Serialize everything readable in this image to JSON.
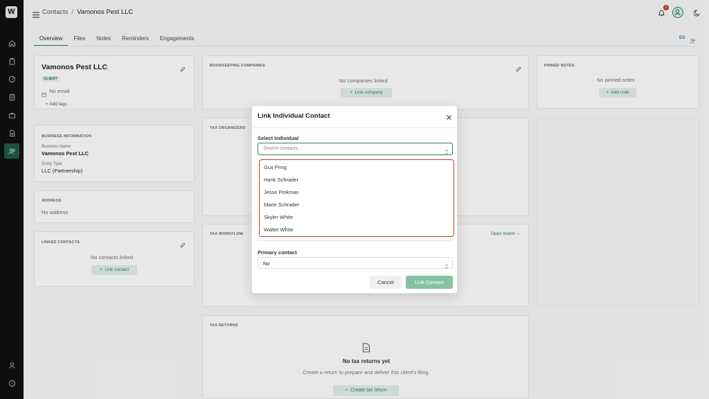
{
  "sidebar": {
    "logo": "W",
    "items": [
      "home-icon",
      "clipboard-icon",
      "gauge-icon",
      "calculator-icon",
      "briefcase-icon",
      "document-icon",
      "users-icon"
    ],
    "bottom": [
      "user-icon",
      "help-icon"
    ]
  },
  "header": {
    "breadcrumb_parent": "Contacts",
    "breadcrumb_sep": "/",
    "breadcrumb_current": "Vamonos Pest LLC",
    "notification_count": "1"
  },
  "tabs": [
    "Overview",
    "Files",
    "Notes",
    "Reminders",
    "Engagements"
  ],
  "right_mini": "EG",
  "contact": {
    "name": "Vamonos Pest LLC",
    "badge": "CLIENT",
    "email": "No email",
    "add_tags": "Add tags"
  },
  "business": {
    "heading": "BUSINESS INFORMATION",
    "name_label": "Business Name",
    "name_value": "Vamonos Pest LLC",
    "entity_label": "Entity Type",
    "entity_value": "LLC (Partnership)"
  },
  "address": {
    "heading": "ADDRESS",
    "value": "No address"
  },
  "linked_contacts": {
    "heading": "LINKED CONTACTS",
    "empty": "No contacts linked",
    "button": "Link contact"
  },
  "bookkeeping": {
    "heading": "BOOKKEEPING COMPANIES",
    "empty": "No companies linked",
    "button": "Link company"
  },
  "tax_organizers": {
    "heading": "TAX ORGANIZERS"
  },
  "tax_workflow": {
    "heading": "TAX WORKFLOW",
    "link": "Open board →"
  },
  "tax_returns": {
    "heading": "TAX RETURNS",
    "empty_title": "No tax returns yet",
    "empty_desc": "Create a return to prepare and deliver this client's filing.",
    "button": "Create tax return"
  },
  "pinned_notes": {
    "heading": "PINNED NOTES",
    "empty": "No pinned notes",
    "button": "Add note"
  },
  "modal": {
    "title": "Link Individual Contact",
    "select_label": "Select Individual",
    "search_placeholder": "Search contacts...",
    "options": [
      "Gus Fring",
      "Hank Schrader",
      "Jesse Pinkman",
      "Marie Schrader",
      "Skyler White",
      "Walter White"
    ],
    "primary_label": "Primary contact",
    "primary_value": "No",
    "cancel": "Cancel",
    "submit": "Link Contact"
  },
  "colors": {
    "accent": "#2e7d5b",
    "highlight": "#c0392b",
    "disabled_accent": "#86c3a3"
  }
}
